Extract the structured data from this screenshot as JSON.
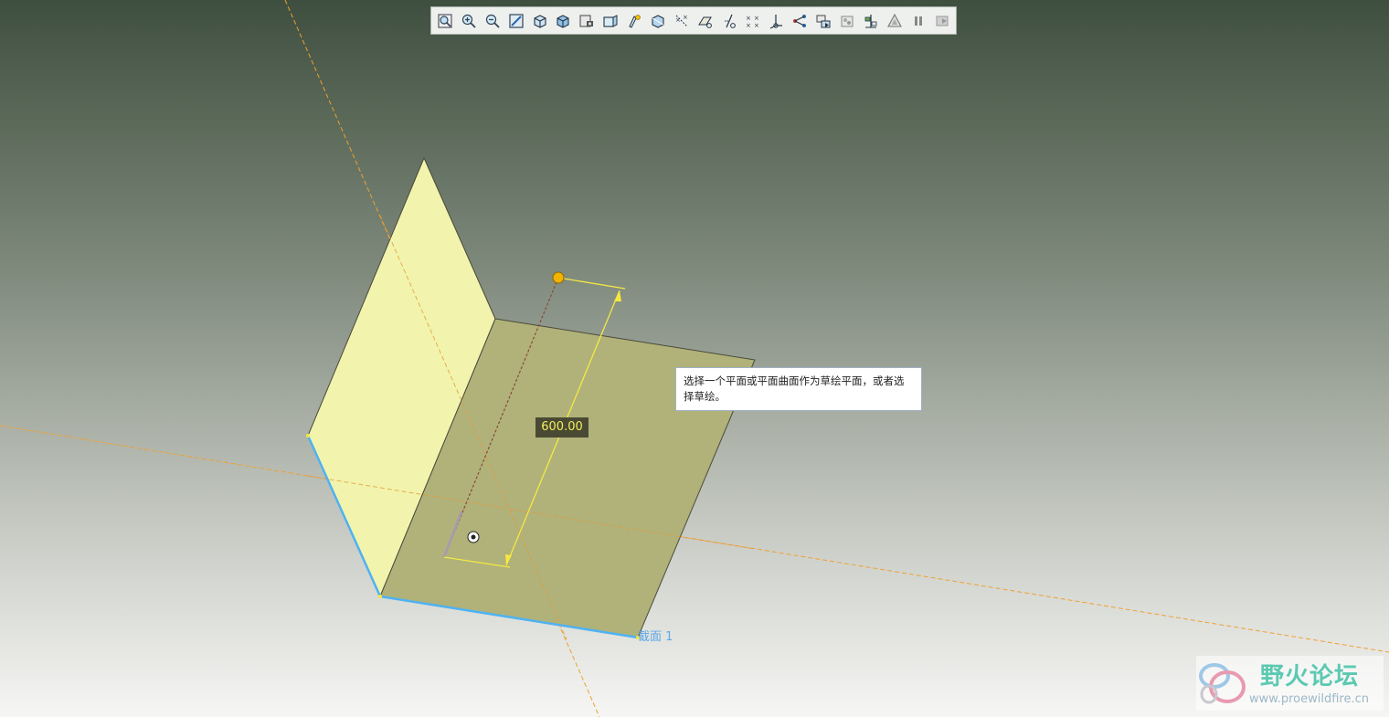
{
  "toolbar": {
    "icons": [
      "refit-icon",
      "zoom-in-icon",
      "zoom-out-icon",
      "repaint-icon",
      "display-style-icon",
      "shading-icon",
      "saved-views-icon",
      "view-manager-icon",
      "annotation-display-icon",
      "plane-display-icon",
      "axis-display-icon",
      "point-display-icon",
      "csys-display-icon",
      "spin-center-icon",
      "model-tree-icon",
      "datum-filter-icon",
      "appearance-icon",
      "layer-icon",
      "render-icon",
      "pause-icon",
      "exit-icon"
    ]
  },
  "tooltip": {
    "text": "选择一个平面或平面曲面作为草绘平面，或者选择草绘。"
  },
  "dimension": {
    "value": "600.00"
  },
  "section": {
    "label": "截面 1"
  },
  "watermark": {
    "title": "野火论坛",
    "url": "www.proewildfire.cn"
  },
  "colors": {
    "vertical_plane": "#f2f4ad",
    "horizontal_plane": "#b0b27a",
    "selected_edge": "#4fb2f2",
    "dimension": "#f5e940",
    "datum_line": "#f0a030"
  }
}
